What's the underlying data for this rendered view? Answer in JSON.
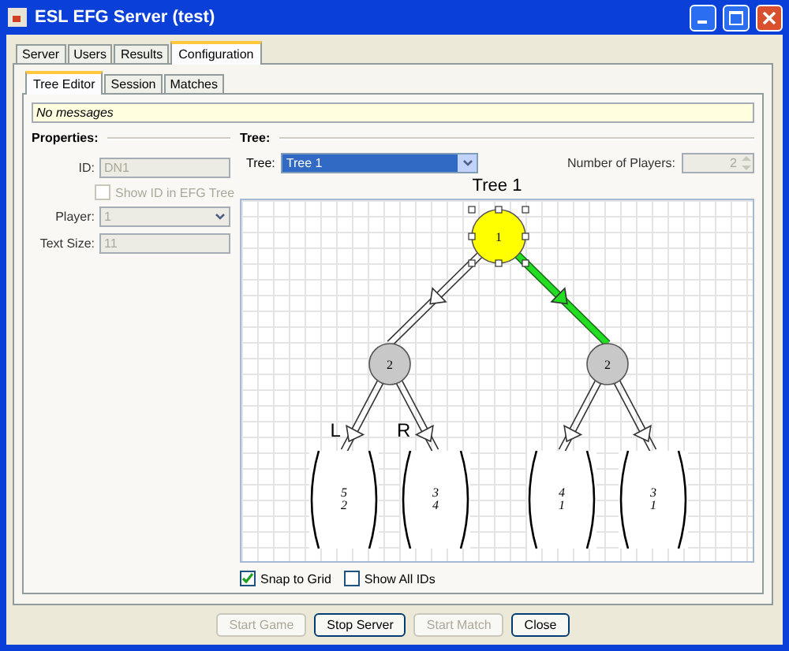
{
  "window": {
    "title": "ESL EFG Server (test)"
  },
  "tabs": [
    {
      "label": "Server",
      "selected": false
    },
    {
      "label": "Users",
      "selected": false
    },
    {
      "label": "Results",
      "selected": false
    },
    {
      "label": "Configuration",
      "selected": true
    }
  ],
  "subtabs": [
    {
      "label": "Tree Editor",
      "selected": true
    },
    {
      "label": "Session",
      "selected": false
    },
    {
      "label": "Matches",
      "selected": false
    }
  ],
  "message": "No messages",
  "properties": {
    "heading": "Properties:",
    "id_label": "ID:",
    "id_value": "DN1",
    "show_id": {
      "label": "Show ID in EFG Tree",
      "checked": false,
      "disabled": true
    },
    "player_label": "Player:",
    "player_value": "1",
    "text_size_label": "Text Size:",
    "text_size_value": "11"
  },
  "tree_panel": {
    "heading": "Tree:",
    "tree_label": "Tree:",
    "tree_value": "Tree 1",
    "players_label": "Number of Players:",
    "players_value": "2",
    "title": "Tree 1",
    "root": {
      "label": "1",
      "selected": true,
      "children": [
        {
          "edge_highlighted": false,
          "label": "2",
          "selected": false,
          "children": [
            {
              "edge_label": "L",
              "edge_highlighted": false,
              "payoffs": [
                "5",
                "2"
              ]
            },
            {
              "edge_label": "R",
              "edge_highlighted": false,
              "payoffs": [
                "3",
                "4"
              ]
            }
          ]
        },
        {
          "edge_highlighted": true,
          "label": "2",
          "selected": false,
          "children": [
            {
              "edge_highlighted": false,
              "payoffs": [
                "4",
                "1"
              ]
            },
            {
              "edge_highlighted": false,
              "payoffs": [
                "3",
                "1"
              ]
            }
          ]
        }
      ]
    },
    "options": [
      {
        "label": "Snap to Grid",
        "checked": true
      },
      {
        "label": "Show All IDs",
        "checked": false
      }
    ]
  },
  "buttons": [
    {
      "label": "Start Game",
      "disabled": true
    },
    {
      "label": "Stop Server",
      "disabled": false
    },
    {
      "label": "Start Match",
      "disabled": true
    },
    {
      "label": "Close",
      "disabled": false
    }
  ]
}
